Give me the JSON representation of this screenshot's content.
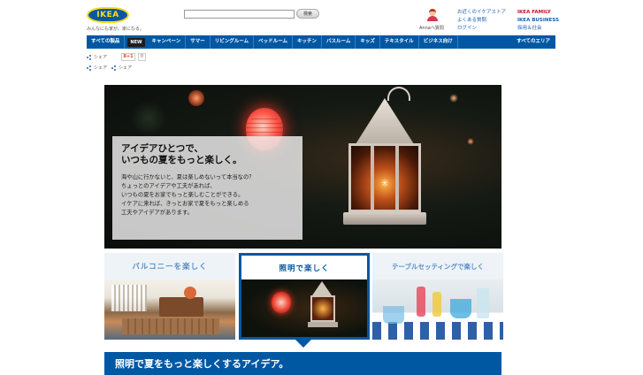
{
  "header": {
    "logo_text": "IKEA",
    "tagline": "みんなにも家が、家になる。",
    "search_button": "検索",
    "user_link": "Annaへ質問",
    "links": [
      "お近くのイケアストア",
      "よくある質問",
      "ログイン"
    ],
    "family": "IKEA FAMILY",
    "business": "IKEA BUSINESS",
    "recruit": "採用＆社会"
  },
  "nav": {
    "items": [
      "すべての製品",
      "キャンペーン",
      "サマー",
      "リビングルーム",
      "ベッドルーム",
      "キッチン",
      "バスルーム",
      "キッズ",
      "テキスタイル",
      "ビジネス向け"
    ],
    "new_badge": "NEW",
    "right": "すべてのエリア"
  },
  "share": {
    "label": "シェア",
    "gplus": "8+1",
    "gplus_count": "0"
  },
  "hero": {
    "title_line1": "アイデアひとつで、",
    "title_line2": "いつもの夏をもっと楽しく。",
    "body": [
      "海や山に行かないと、夏は楽しめないって本当なの？",
      "ちょっとのアイデアや工夫があれば、",
      "いつもの夏をお家でもっと楽しむことができる。",
      "イケアに来れば、きっとお家で夏をもっと楽しめる",
      "工夫やアイデアがあります。"
    ]
  },
  "tabs": [
    {
      "label": "バルコニーを楽しく",
      "active": false
    },
    {
      "label": "照明で楽しく",
      "active": true
    },
    {
      "label": "テーブルセッティングで楽しく",
      "active": false
    }
  ],
  "section": {
    "title": "照明で夏をもっと楽しくするアイデア。"
  },
  "colors": {
    "brand_blue": "#0058a3",
    "brand_yellow": "#ffda1a"
  }
}
